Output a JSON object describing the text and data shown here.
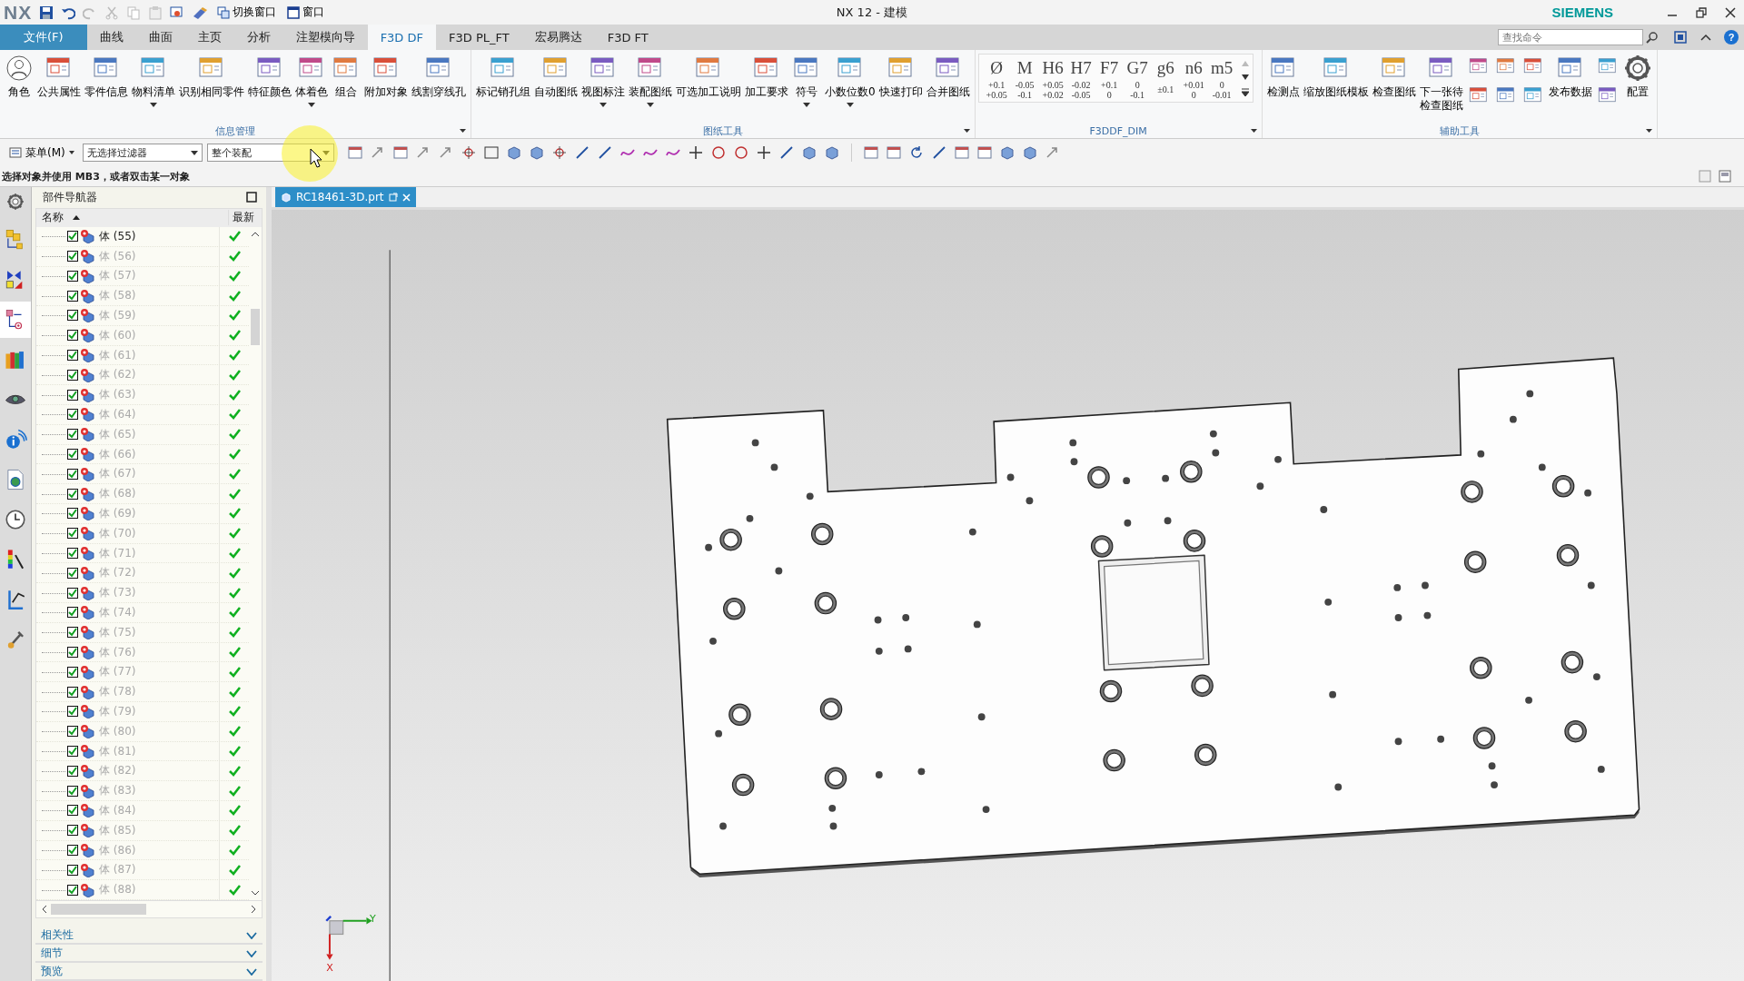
{
  "title_bar": {
    "logo": "NX",
    "quick_access": [
      {
        "label": "切换窗口"
      },
      {
        "label": "窗口"
      }
    ],
    "title": "NX 12 - 建模",
    "brand": "SIEMENS"
  },
  "menu_tabs": [
    {
      "label": "文件(F)",
      "kind": "file",
      "selected": false
    },
    {
      "label": "曲线",
      "kind": "tab",
      "selected": false
    },
    {
      "label": "曲面",
      "kind": "tab",
      "selected": false
    },
    {
      "label": "主页",
      "kind": "tab",
      "selected": false
    },
    {
      "label": "分析",
      "kind": "tab",
      "selected": false
    },
    {
      "label": "注塑模向导",
      "kind": "tab",
      "selected": false
    },
    {
      "label": "F3D DF",
      "kind": "tab",
      "selected": true
    },
    {
      "label": "F3D PL_FT",
      "kind": "tab",
      "selected": false
    },
    {
      "label": "宏易腾达",
      "kind": "tab",
      "selected": false
    },
    {
      "label": "F3D FT",
      "kind": "tab",
      "selected": false
    }
  ],
  "command_search": {
    "placeholder": "查找命令"
  },
  "help_button": "?",
  "ribbon_groups": [
    {
      "title": "信息管理",
      "kind": "buttons",
      "items": [
        {
          "kind": "button",
          "label": "角色",
          "dropdown": false
        },
        {
          "kind": "button",
          "label": "公共属性",
          "dropdown": false
        },
        {
          "kind": "button",
          "label": "零件信息",
          "dropdown": false
        },
        {
          "kind": "button",
          "label": "物料清单",
          "dropdown": true
        },
        {
          "kind": "button",
          "label": "识别相同零件",
          "dropdown": false
        },
        {
          "kind": "button",
          "label": "特征颜色",
          "dropdown": false
        },
        {
          "kind": "button",
          "label": "体着色",
          "dropdown": true
        },
        {
          "kind": "button",
          "label": "组合",
          "dropdown": false
        },
        {
          "kind": "button",
          "label": "附加对象",
          "dropdown": false
        },
        {
          "kind": "button",
          "label": "线割穿线孔",
          "dropdown": false
        }
      ]
    },
    {
      "title": "图纸工具",
      "kind": "buttons",
      "items": [
        {
          "kind": "button",
          "label": "标记销孔组",
          "dropdown": false
        },
        {
          "kind": "button",
          "label": "自动图纸",
          "dropdown": false
        },
        {
          "kind": "button",
          "label": "视图标注",
          "dropdown": true
        },
        {
          "kind": "button",
          "label": "装配图纸",
          "dropdown": true
        },
        {
          "kind": "button",
          "label": "可选加工说明",
          "dropdown": false
        },
        {
          "kind": "button",
          "label": "加工要求",
          "dropdown": false
        },
        {
          "kind": "button",
          "label": "符号",
          "dropdown": true
        },
        {
          "kind": "button",
          "label": "小数位数0",
          "dropdown": true
        },
        {
          "kind": "button",
          "label": "快速打印",
          "dropdown": false
        },
        {
          "kind": "button",
          "label": "合并图纸",
          "dropdown": false
        }
      ]
    },
    {
      "title": "F3DDF_DIM",
      "kind": "gallery",
      "tolerances": [
        {
          "symbol": "Ø",
          "kind": "limits",
          "upper": "+0.1",
          "lower": "+0.05"
        },
        {
          "symbol": "M",
          "kind": "limits",
          "upper": "-0.05",
          "lower": "-0.1"
        },
        {
          "symbol": "H6",
          "kind": "limits",
          "upper": "+0.05",
          "lower": "+0.02"
        },
        {
          "symbol": "H7",
          "kind": "limits",
          "upper": "-0.02",
          "lower": "-0.05"
        },
        {
          "symbol": "F7",
          "kind": "limits",
          "upper": "+0.1",
          "lower": "0"
        },
        {
          "symbol": "G7",
          "kind": "limits",
          "upper": "0",
          "lower": "-0.1"
        },
        {
          "symbol": "g6",
          "kind": "symmetric",
          "upper": "±0.1"
        },
        {
          "symbol": "n6",
          "kind": "limits",
          "upper": "+0.01",
          "lower": "0"
        },
        {
          "symbol": "m5",
          "kind": "limits",
          "upper": "0",
          "lower": "-0.01"
        }
      ]
    },
    {
      "title": "辅助工具",
      "kind": "buttons",
      "items": [
        {
          "kind": "button",
          "label": "检测点",
          "dropdown": false
        },
        {
          "kind": "button",
          "label": "缩放图纸模板",
          "dropdown": false
        },
        {
          "kind": "button",
          "label": "检查图纸",
          "dropdown": false
        },
        {
          "kind": "button",
          "label_lines": [
            "下一张待",
            "检查图纸"
          ],
          "dropdown": false
        },
        {
          "kind": "icon_column"
        },
        {
          "kind": "icon_column"
        },
        {
          "kind": "icon_column"
        },
        {
          "kind": "button",
          "label": "发布数据",
          "dropdown": false
        },
        {
          "kind": "icon_column"
        },
        {
          "kind": "button",
          "label": "配置",
          "dropdown": false
        }
      ]
    }
  ],
  "toolbar": {
    "menu_button": "菜单(M)",
    "selection_filters": [
      "无选择过滤器",
      "整个装配"
    ]
  },
  "status_hint": "选择对象并使用 MB3，或者双击某一对象",
  "resource_bar": [
    {
      "selected": false
    },
    {
      "selected": false
    },
    {
      "selected": true
    },
    {
      "selected": false
    },
    {
      "selected": false
    },
    {
      "selected": false
    },
    {
      "selected": false
    },
    {
      "selected": false
    },
    {
      "selected": false
    },
    {
      "selected": false
    },
    {
      "selected": false
    }
  ],
  "navigator": {
    "title": "部件导航器",
    "columns": [
      "名称",
      "最新"
    ],
    "rows": [
      {
        "name": "体 (55)",
        "checked": true,
        "dimmed": false,
        "up_to_date": true
      },
      {
        "name": "体 (56)",
        "checked": true,
        "dimmed": true,
        "up_to_date": true
      },
      {
        "name": "体 (57)",
        "checked": true,
        "dimmed": true,
        "up_to_date": true
      },
      {
        "name": "体 (58)",
        "checked": true,
        "dimmed": true,
        "up_to_date": true
      },
      {
        "name": "体 (59)",
        "checked": true,
        "dimmed": true,
        "up_to_date": true
      },
      {
        "name": "体 (60)",
        "checked": true,
        "dimmed": true,
        "up_to_date": true
      },
      {
        "name": "体 (61)",
        "checked": true,
        "dimmed": true,
        "up_to_date": true
      },
      {
        "name": "体 (62)",
        "checked": true,
        "dimmed": true,
        "up_to_date": true
      },
      {
        "name": "体 (63)",
        "checked": true,
        "dimmed": true,
        "up_to_date": true
      },
      {
        "name": "体 (64)",
        "checked": true,
        "dimmed": true,
        "up_to_date": true
      },
      {
        "name": "体 (65)",
        "checked": true,
        "dimmed": true,
        "up_to_date": true
      },
      {
        "name": "体 (66)",
        "checked": true,
        "dimmed": true,
        "up_to_date": true
      },
      {
        "name": "体 (67)",
        "checked": true,
        "dimmed": true,
        "up_to_date": true
      },
      {
        "name": "体 (68)",
        "checked": true,
        "dimmed": true,
        "up_to_date": true
      },
      {
        "name": "体 (69)",
        "checked": true,
        "dimmed": true,
        "up_to_date": true
      },
      {
        "name": "体 (70)",
        "checked": true,
        "dimmed": true,
        "up_to_date": true
      },
      {
        "name": "体 (71)",
        "checked": true,
        "dimmed": true,
        "up_to_date": true
      },
      {
        "name": "体 (72)",
        "checked": true,
        "dimmed": true,
        "up_to_date": true
      },
      {
        "name": "体 (73)",
        "checked": true,
        "dimmed": true,
        "up_to_date": true
      },
      {
        "name": "体 (74)",
        "checked": true,
        "dimmed": true,
        "up_to_date": true
      },
      {
        "name": "体 (75)",
        "checked": true,
        "dimmed": true,
        "up_to_date": true
      },
      {
        "name": "体 (76)",
        "checked": true,
        "dimmed": true,
        "up_to_date": true
      },
      {
        "name": "体 (77)",
        "checked": true,
        "dimmed": true,
        "up_to_date": true
      },
      {
        "name": "体 (78)",
        "checked": true,
        "dimmed": true,
        "up_to_date": true
      },
      {
        "name": "体 (79)",
        "checked": true,
        "dimmed": true,
        "up_to_date": true
      },
      {
        "name": "体 (80)",
        "checked": true,
        "dimmed": true,
        "up_to_date": true
      },
      {
        "name": "体 (81)",
        "checked": true,
        "dimmed": true,
        "up_to_date": true
      },
      {
        "name": "体 (82)",
        "checked": true,
        "dimmed": true,
        "up_to_date": true
      },
      {
        "name": "体 (83)",
        "checked": true,
        "dimmed": true,
        "up_to_date": true
      },
      {
        "name": "体 (84)",
        "checked": true,
        "dimmed": true,
        "up_to_date": true
      },
      {
        "name": "体 (85)",
        "checked": true,
        "dimmed": true,
        "up_to_date": true
      },
      {
        "name": "体 (86)",
        "checked": true,
        "dimmed": true,
        "up_to_date": true
      },
      {
        "name": "体 (87)",
        "checked": true,
        "dimmed": true,
        "up_to_date": true
      },
      {
        "name": "体 (88)",
        "checked": true,
        "dimmed": true,
        "up_to_date": true
      }
    ],
    "sections": [
      "相关性",
      "细节",
      "预览"
    ]
  },
  "graphics": {
    "tab": "RC18461-3D.prt",
    "triad_labels": [
      "Y",
      "X"
    ]
  }
}
